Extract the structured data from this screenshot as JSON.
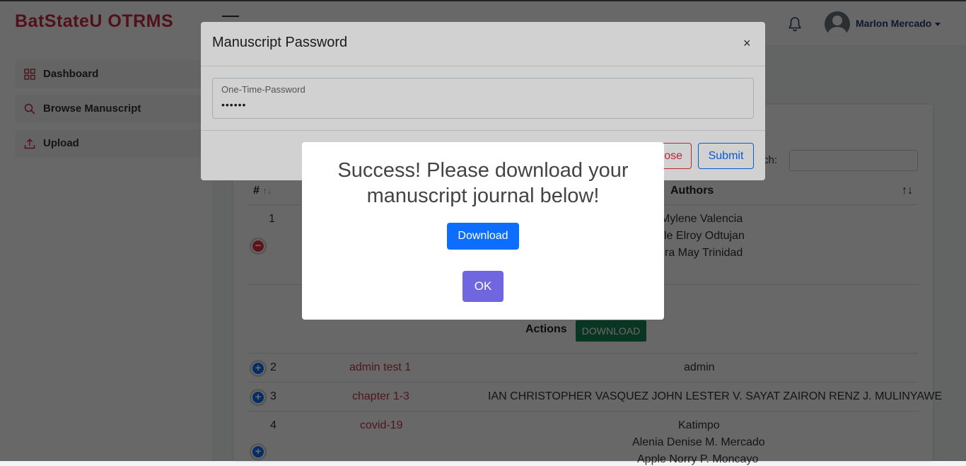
{
  "app": {
    "brand": "BatStateU OTRMS"
  },
  "header": {
    "username": "Marlon Mercado"
  },
  "sidebar": {
    "items": [
      {
        "label": "Dashboard",
        "icon": "grid-icon"
      },
      {
        "label": "Browse Manuscript",
        "icon": "search-icon"
      },
      {
        "label": "Upload",
        "icon": "upload-icon"
      }
    ]
  },
  "table": {
    "search_label": "rch:",
    "headers": {
      "number": "#",
      "authors": "Authors"
    },
    "sort_glyph": "↑↓",
    "row1": {
      "number": "1",
      "authors": [
        "Mylene Valencia",
        "le Elroy Odtujan",
        "ra May Trinidad"
      ],
      "actions_label": "Actions",
      "download_label": "DOWNLOAD"
    },
    "rows": [
      {
        "number": "2",
        "title": "admin test 1",
        "authors": "admin"
      },
      {
        "number": "3",
        "title": "chapter 1-3",
        "authors": "IAN CHRISTOPHER VASQUEZ JOHN LESTER V. SAYAT ZAIRON RENZ J. MULINYAWE"
      },
      {
        "number": "4",
        "title": "covid-19",
        "authors_lines": [
          "Katimpo",
          "Alenia Denise M. Mercado",
          "Apple Norry P. Moncayo"
        ]
      }
    ]
  },
  "password_modal": {
    "title": "Manuscript Password",
    "close_symbol": "×",
    "otp_label": "One-Time-Password",
    "otp_value": "••••••",
    "close_label": "ose",
    "submit_label": "Submit"
  },
  "success_modal": {
    "message": "Success! Please download your manuscript journal below!",
    "download_label": "Download",
    "ok_label": "OK"
  },
  "colors": {
    "brand": "#c62a45",
    "link": "#c0394f",
    "primary": "#0d6efd",
    "ok": "#7066e0",
    "success": "#198754"
  }
}
